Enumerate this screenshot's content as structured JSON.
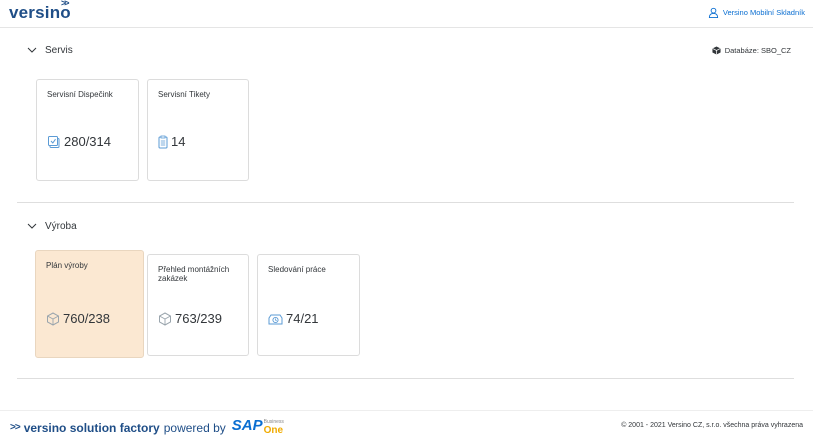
{
  "header": {
    "logo": "versino",
    "logo_mark": ">>",
    "user_name": "Versino Mobilní Skladník"
  },
  "sections": {
    "servis": {
      "title": "Servis",
      "database_label": "Databáze: SBO_CZ",
      "tiles": [
        {
          "title": "Servisní Dispečink",
          "value": "280/314",
          "icon": "service-dispatch-icon"
        },
        {
          "title": "Servisní Tikety",
          "value": "14",
          "icon": "ticket-clipboard-icon"
        }
      ]
    },
    "vyroba": {
      "title": "Výroba",
      "tiles": [
        {
          "title": "Plán výroby",
          "value": "760/238",
          "icon": "production-plan-icon",
          "active": true
        },
        {
          "title": "Přehled montážních zakázek",
          "value": "763/239",
          "icon": "assembly-orders-icon"
        },
        {
          "title": "Sledování práce",
          "value": "74/21",
          "icon": "work-tracking-icon"
        }
      ]
    }
  },
  "footer": {
    "mark": ">>",
    "brand": "versino solution factory",
    "powered": "powered by",
    "sap_main": "SAP",
    "sap_business": "Business",
    "sap_one": "One",
    "copyright": "© 2001 - 2021 Versino CZ, s.r.o. všechna práva vyhrazena"
  },
  "colors": {
    "accent": "#0a6ed1",
    "brand": "#1f4e87",
    "active_tile": "#fbe8d2",
    "sap_one": "#f0ab00"
  }
}
